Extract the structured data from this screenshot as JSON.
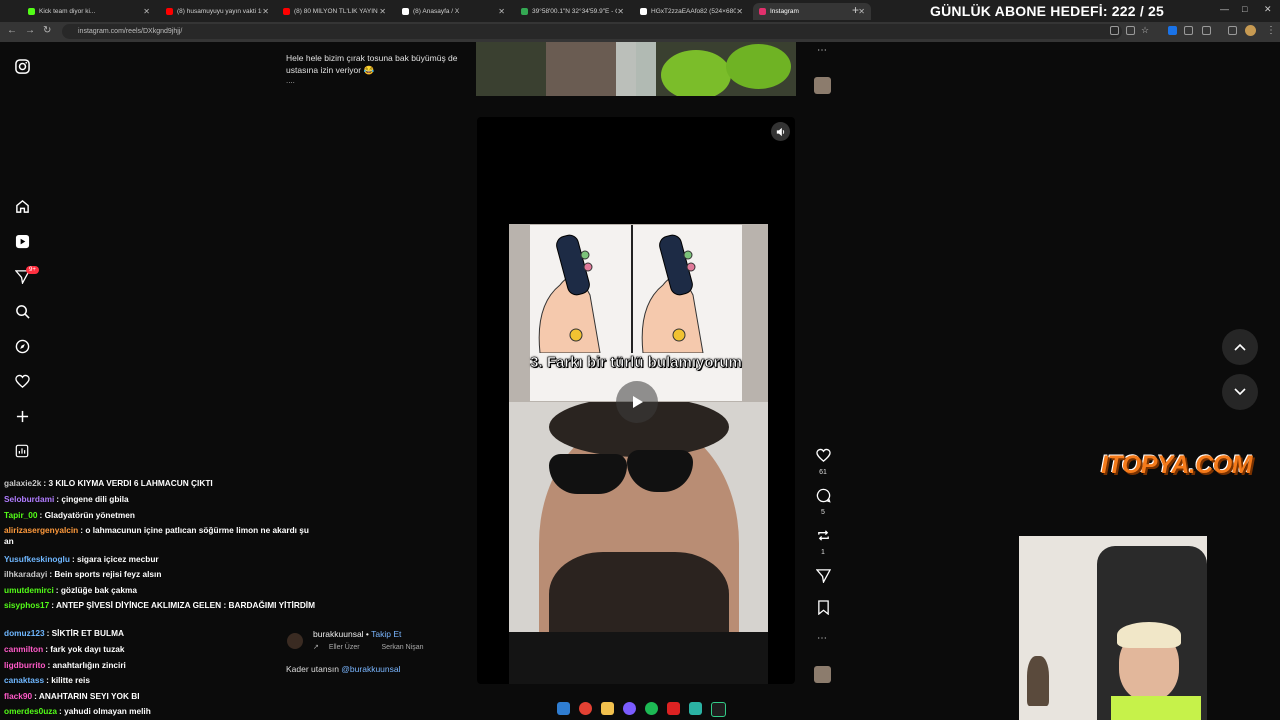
{
  "browser": {
    "tabs": [
      {
        "label": "Kick team diyor ki...",
        "color": "#53fc18",
        "active": false
      },
      {
        "label": "(8) husamuyuyu yayın vakti 16 -",
        "color": "#ff0000",
        "active": false
      },
      {
        "label": "(8) 80 MİLYON TL'LİK YAYIN",
        "color": "#ff0000",
        "active": false
      },
      {
        "label": "(8) Anasayfa / X",
        "color": "#ffffff",
        "active": false
      },
      {
        "label": "39°58'00.1\"N 32°34'59.9\"E - G...",
        "color": "#34a853",
        "active": false
      },
      {
        "label": "HGxT2zzaEAAfo82 (524×680)",
        "color": "#ffffff",
        "active": false
      },
      {
        "label": "Instagram",
        "color": "#e1306c",
        "active": true
      }
    ],
    "url": "instagram.com/reels/DXkgnd9jhjj/"
  },
  "overlay": {
    "subscriber_goal": "GÜNLÜK ABONE HEDEFİ: 222 / 25",
    "logo": "ITOPYA.COM"
  },
  "sidebar": {
    "notif_badge": "9+"
  },
  "reel_prev": {
    "caption": "Hele hele bizim çırak tosuna bak büyümüş de ustasına izin veriyor 😂",
    "more": "...."
  },
  "reel": {
    "overlay_text": "3. Farkı bir türlü bulamıyorum",
    "author": "burakkuunsal",
    "follow_label": "Takip Et",
    "music_1": "Eller Üzer",
    "music_2": "Serkan Nişan",
    "caption_text": "Kader utansın ",
    "caption_tag": "@burakkuunsal",
    "likes": "61",
    "comments": "5",
    "reposts": "1"
  },
  "chat": [
    {
      "user": "galaxie2k",
      "text": ": 3 KILO KIYMA VERDI 6 LAHMACUN ÇIKTI",
      "color": "#c8c8c8"
    },
    {
      "user": "Seloburdami",
      "text": ": çingene dili gbila",
      "color": "#b07cff"
    },
    {
      "user": "Tapir_00",
      "text": ": Gladyatörün yönetmen",
      "color": "#53fc18"
    },
    {
      "user": "alirizasergenyalcin",
      "text": ": o lahmacunun içine patlıcan söğürme limon ne akardı şu an",
      "color": "#ff9a3c"
    },
    {
      "user": "Yusufkeskinoglu",
      "text": ": sigara içicez mecbur",
      "color": "#6fb7ff"
    },
    {
      "user": "ilhkaradayi",
      "text": ": Bein sports rejisi feyz alsın",
      "color": "#c8c8c8"
    },
    {
      "user": "umutdemirci",
      "text": ": gözlüğe bak çakma",
      "color": "#53fc18"
    },
    {
      "user": "sisyphos17",
      "text": ": ANTEP ŞİVESİ DİYİNCE AKLIMIZA GELEN : BARDAĞIMI YİTİRDİM",
      "color": "#53fc18"
    },
    {
      "user": "domuz123",
      "text": ": SİKTİR ET BULMA",
      "color": "#6fb7ff"
    },
    {
      "user": "canmilton",
      "text": ": fark yok dayı tuzak",
      "color": "#ff5ac8"
    },
    {
      "user": "ligdburrito",
      "text": ": anahtarlığın zinciri",
      "color": "#ff5ac8"
    },
    {
      "user": "canaktass",
      "text": ": kilitte reis",
      "color": "#6fb7ff"
    },
    {
      "user": "flack90",
      "text": ": ANAHTARIN SEYI YOK BI",
      "color": "#ff5ac8"
    },
    {
      "user": "omerdes0uza",
      "text": ": yahudi olmayan melih",
      "color": "#53fc18"
    }
  ]
}
